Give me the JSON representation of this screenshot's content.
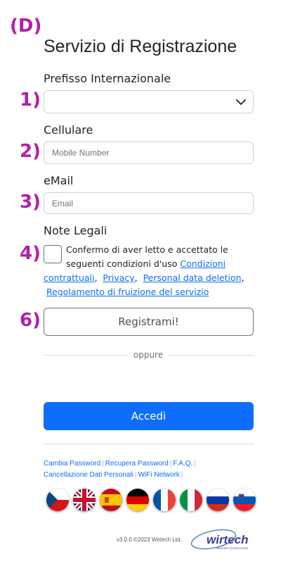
{
  "markers": {
    "page": "(D)",
    "m1": "1)",
    "m2": "2)",
    "m3": "3)",
    "m4": "4)",
    "m6": "6)"
  },
  "title": "Servizio di Registrazione",
  "prefix": {
    "label": "Prefisso Internazionale",
    "value": ""
  },
  "mobile": {
    "label": "Cellulare",
    "placeholder": "Mobile Number"
  },
  "email": {
    "label": "eMail",
    "placeholder": "Email"
  },
  "legal": {
    "label": "Note Legali",
    "text_line1": "Confermo di aver letto e accettato le",
    "text_line2": "seguenti condizioni d'uso",
    "link_conditions_1": "Condizioni",
    "link_conditions_2": "contrattuali",
    "link_privacy": "Privacy",
    "link_data_deletion": "Personal data deletion",
    "link_regulation": "Regolamento di fruizione del servizio"
  },
  "register_button": "Registrami!",
  "divider_text": "oppure",
  "login_button": "Accedi",
  "footer_links": {
    "change_password": "Cambia Password",
    "recover_password": "Recupera Password",
    "faq": "F.A.Q.",
    "delete_data": "Cancellazione Dati Personali",
    "wifi_network": "WiFi Network"
  },
  "languages": [
    "czech-flag",
    "uk-flag",
    "spain-flag",
    "germany-flag",
    "france-flag",
    "italy-flag",
    "russia-flag",
    "slovenia-flag"
  ],
  "version": "v3.0.0 ©2023 Wirtech Ltd.",
  "logo": {
    "name": "wirtech",
    "tagline": "WIRELESS TECHNOLOGIES"
  },
  "colors": {
    "accent": "#0d6efd",
    "marker": "#b31fa8"
  }
}
